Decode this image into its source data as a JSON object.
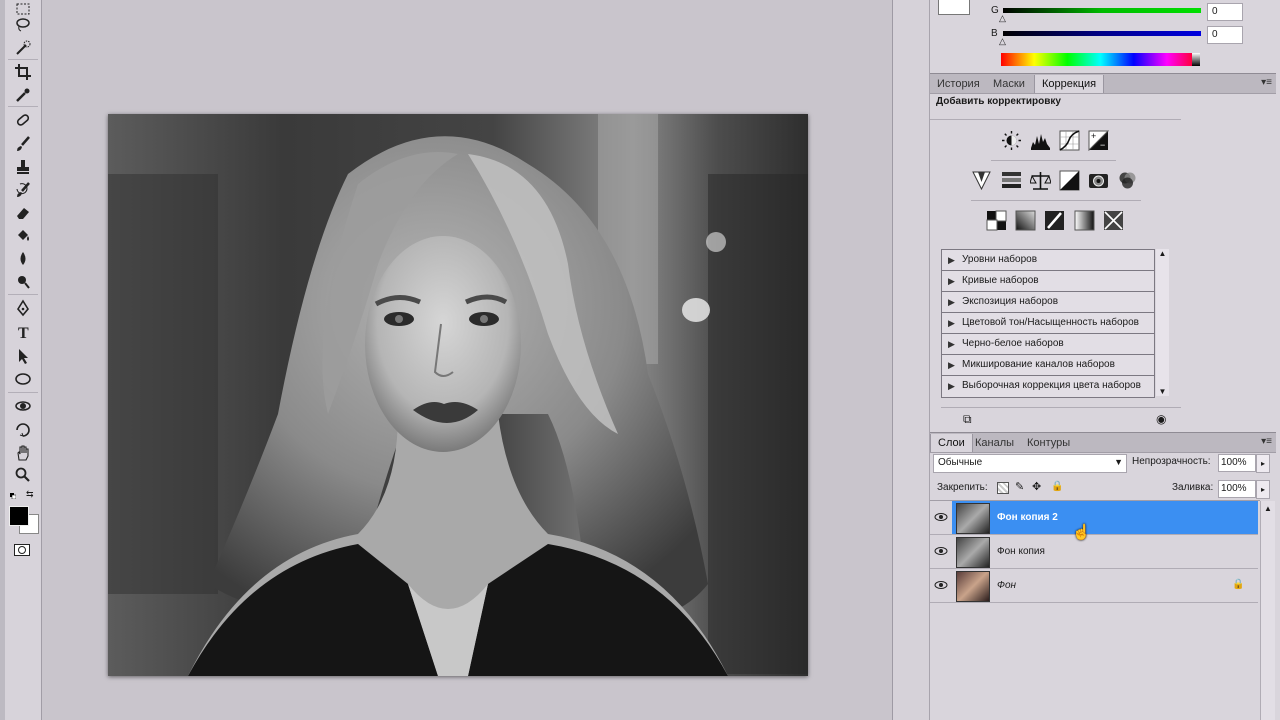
{
  "toolbox": {
    "tools": [
      "marquee-icon",
      "lasso-icon",
      "quick-selection-icon",
      "crop-icon",
      "eyedropper-icon",
      "healing-brush-icon",
      "brush-icon",
      "clone-stamp-icon",
      "history-brush-icon",
      "eraser-icon",
      "paint-bucket-icon",
      "blur-icon",
      "dodge-icon",
      "pen-icon",
      "type-icon",
      "path-selection-icon",
      "ellipse-icon",
      "rotate-3d-icon",
      "orbit-3d-icon",
      "hand-icon",
      "zoom-icon"
    ],
    "foreground_color": "#000000",
    "background_color": "#ffffff"
  },
  "color_panel": {
    "g_label": "G",
    "g_value": "0",
    "b_label": "B",
    "b_value": "0"
  },
  "adjustments_panel": {
    "tabs": [
      "История",
      "Маски",
      "Коррекция"
    ],
    "active_tab": "Коррекция",
    "heading": "Добавить корректировку",
    "icons_row1": [
      "brightness-contrast-icon",
      "levels-icon",
      "curves-icon",
      "exposure-icon"
    ],
    "icons_row2": [
      "vibrance-icon",
      "hue-saturation-icon",
      "color-balance-icon",
      "black-white-icon",
      "photo-filter-icon",
      "channel-mixer-icon"
    ],
    "icons_row3": [
      "invert-icon",
      "posterize-icon",
      "threshold-icon",
      "gradient-map-icon",
      "selective-color-icon"
    ],
    "presets": [
      "Уровни наборов",
      "Кривые наборов",
      "Экспозиция наборов",
      "Цветовой тон/Насыщенность наборов",
      "Черно-белое наборов",
      "Микширование каналов наборов",
      "Выборочная коррекция цвета наборов"
    ]
  },
  "layers_panel": {
    "tabs": [
      "Слои",
      "Каналы",
      "Контуры"
    ],
    "active_tab": "Слои",
    "blend_mode": "Обычные",
    "opacity_label": "Непрозрачность:",
    "opacity_value": "100%",
    "lock_label": "Закрепить:",
    "fill_label": "Заливка:",
    "fill_value": "100%",
    "layers": [
      {
        "name": "Фон копия 2",
        "selected": true,
        "locked": false
      },
      {
        "name": "Фон копия",
        "selected": false,
        "locked": false
      },
      {
        "name": "Фон",
        "selected": false,
        "locked": true
      }
    ]
  },
  "colors": {
    "selection": "#3b8ff2",
    "panel_bg": "#d9d5dc",
    "canvas_bg": "#c9c5cc"
  }
}
